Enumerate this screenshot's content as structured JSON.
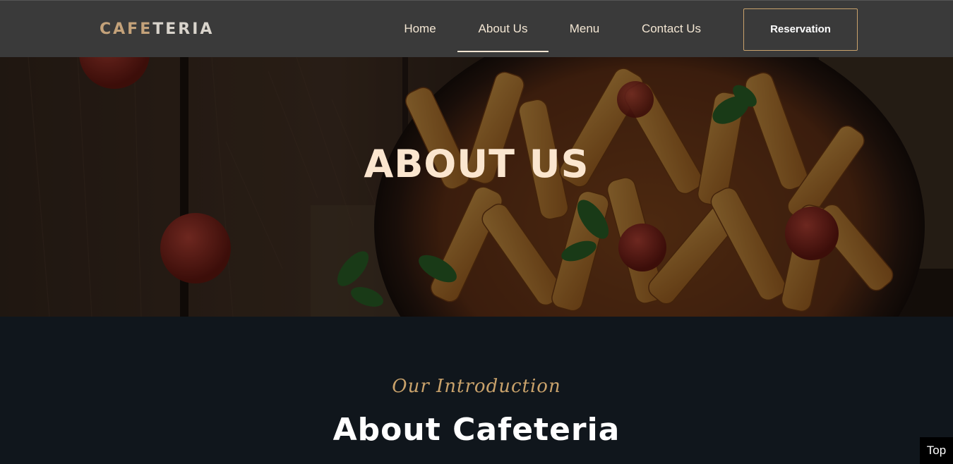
{
  "header": {
    "logo_part_a": "CAFE",
    "logo_part_b": "TERIA",
    "nav": [
      {
        "label": "Home"
      },
      {
        "label": "About Us",
        "active": true
      },
      {
        "label": "Menu"
      },
      {
        "label": "Contact Us"
      }
    ],
    "reservation_label": "Reservation"
  },
  "hero": {
    "title": "ABOUT US"
  },
  "intro": {
    "subtitle": "Our Introduction",
    "title": "About Cafeteria"
  },
  "back_to_top_label": "Top",
  "colors": {
    "header_bg": "#3a3a3a",
    "accent_gold": "#c9a26b",
    "nav_text": "#f3e6d3",
    "page_bg": "#10161c",
    "hero_title": "#fbe6cf"
  }
}
